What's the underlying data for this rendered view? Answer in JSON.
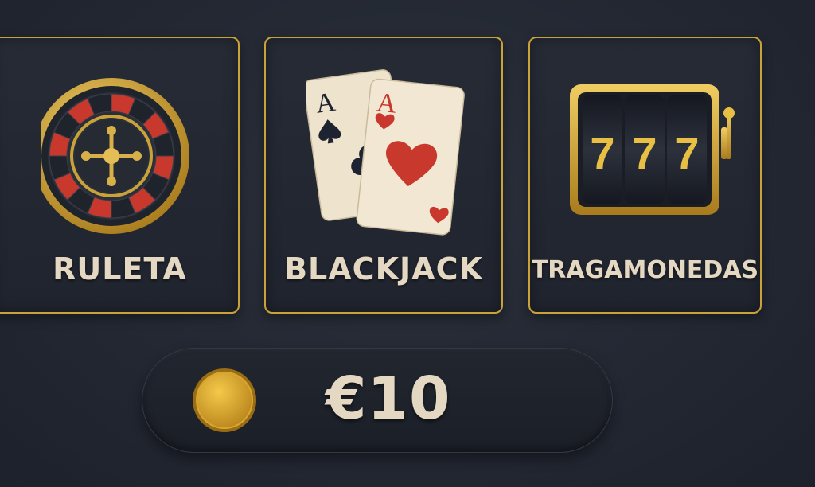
{
  "games": [
    {
      "label": "RULETA",
      "icon": "roulette-wheel-icon"
    },
    {
      "label": "BLACKJACK",
      "icon": "playing-cards-icon"
    },
    {
      "label": "TRAGAMONEDAS",
      "icon": "slot-machine-icon"
    }
  ],
  "blackjack_cards": {
    "back_rank": "A",
    "front_rank": "A"
  },
  "slots": {
    "reels": [
      "7",
      "7",
      "7"
    ]
  },
  "balance": {
    "amount": "€10",
    "icon": "coin-icon"
  },
  "colors": {
    "background": "#232833",
    "gold": "#c9a23a",
    "label": "#e4d8c2",
    "red": "#c8382c"
  }
}
